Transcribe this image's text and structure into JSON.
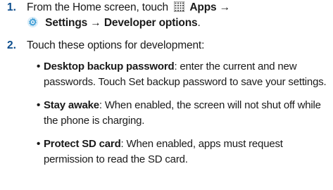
{
  "steps": [
    {
      "number": "1.",
      "text_before": "From the Home screen, touch",
      "apps_label": "Apps",
      "arrow1": "→",
      "settings_label": "Settings",
      "arrow2": "→",
      "developer_label": "Developer options",
      "period": "."
    },
    {
      "number": "2.",
      "text": "Touch these options for development:"
    }
  ],
  "bullets": [
    {
      "term": "Desktop backup password",
      "sep": ":",
      "line1": " enter the current and new",
      "line2": "passwords. Touch Set backup password to save your settings."
    },
    {
      "term": "Stay awake",
      "sep": ":",
      "line1": " When enabled, the screen will not shut off while",
      "line2": "the phone is charging."
    },
    {
      "term": "Protect SD card",
      "sep": ":",
      "line1": " When enabled, apps must request",
      "line2": "permission to read the SD card."
    }
  ],
  "bullet_glyph": "•",
  "colors": {
    "step_number": "#0b4c8c",
    "apps_grid": "#555555",
    "gear": "#4aa3d8"
  },
  "icons": [
    "apps-grid-icon",
    "settings-gear-icon"
  ]
}
